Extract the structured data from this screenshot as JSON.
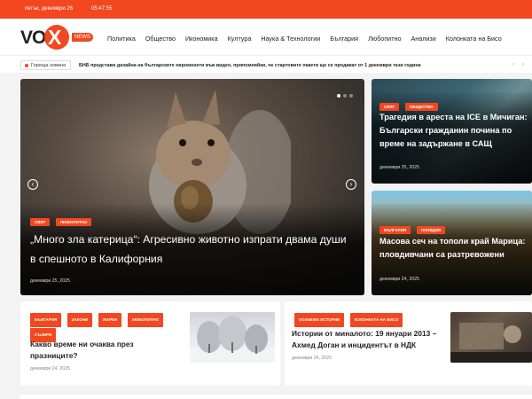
{
  "topbar": {
    "date": "петък, декември 26",
    "time": "05:47:55"
  },
  "logo": {
    "text_vo": "VO",
    "text_x": "X",
    "text_news": "NEWS"
  },
  "nav": [
    "Политика",
    "Общество",
    "Икономика",
    "Култура",
    "Наука & Технологии",
    "България",
    "Любопитно",
    "Анализи",
    "Колонката на Бисо"
  ],
  "ticker": {
    "label": "Гореща новина",
    "headline": "БНБ представи дизайна на българските евромонети във видео, припомняйки, че стартовите пакети ще се продават от 1 декември тази година",
    "prev_icon": "‹",
    "next_icon": "›"
  },
  "hero": {
    "categories": [
      "СВЯТ",
      "ЛЮБОПИТНО"
    ],
    "title": "„Много зла катерица“: Агресивно животно изпрати двама души в спешното в Калифорния",
    "date": "декември 25, 2025",
    "prev_arrow": "‹",
    "next_arrow": "›"
  },
  "side": [
    {
      "categories": [
        "СВЯТ",
        "ОБЩЕСТВО"
      ],
      "title": "Трагедия в ареста на ICE в Мичиган: Български гражданин почина по време на задържане в САЩ",
      "date": "декември 25, 2025"
    },
    {
      "categories": [
        "БЪЛГАРИЯ",
        "ПЛОВДИВ"
      ],
      "title": "Масова сеч на тополи край Марица: пловдивчани са разтревожени",
      "date": "декември 24, 2025"
    }
  ],
  "cards": [
    {
      "categories": [
        "БЪЛГАРИЯ",
        "ЗАКОНИ",
        "ЖАРКИ",
        "ЛЮБОПИТНО",
        "СЪЗИРИ"
      ],
      "title": "Какво време ни очаква през празниците?",
      "date": "декември 24, 2025"
    },
    {
      "categories": [
        "VOXNEWS ИСТОРИИ",
        "КОЛОНКАТА НА БИСО"
      ],
      "title": "Истории от миналото: 19 януари 2013 – Ахмед Доган и инцидентът в НДК",
      "date": "декември 24, 2025"
    }
  ],
  "colors": {
    "accent": "#f2471f",
    "dark": "#222222"
  }
}
